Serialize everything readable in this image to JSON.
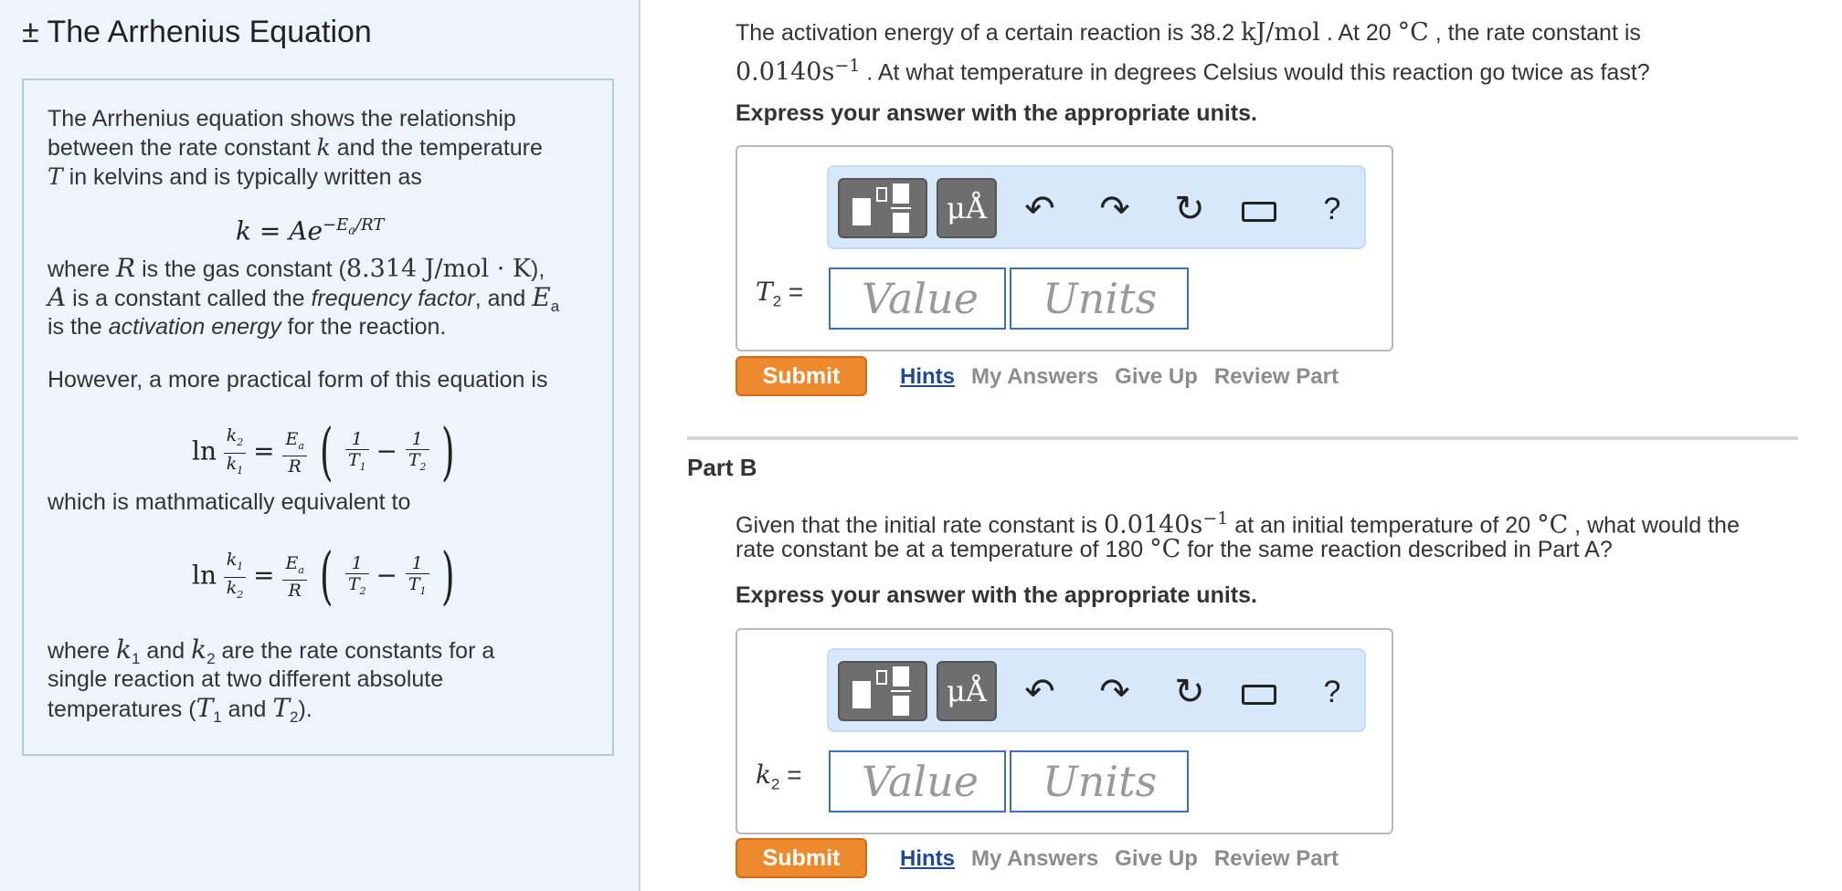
{
  "sidebar": {
    "title": "± The Arrhenius Equation",
    "intro_line1": "The Arrhenius equation shows the relationship",
    "intro_line2_a": "between the rate constant ",
    "intro_line2_b": " and the temperature",
    "intro_line3": " in kelvins and is typically written as",
    "eq_main": "k = Ae",
    "eq_main_exp": "−E",
    "eq_main_exp2": "/RT",
    "where_line1_a": "where ",
    "where_line1_b": " is the gas constant (",
    "where_line1_val": "8.314 J/mol · K",
    "where_line1_c": "),",
    "where_line2_a": " is a constant called the ",
    "where_line2_em": "frequency factor",
    "where_line2_b": ", and ",
    "where_line3_a": "is the ",
    "where_line3_em": "activation energy",
    "where_line3_b": " for the reaction.",
    "practical": "However, a more practical form of this equation is",
    "equivalent": "which is mathmatically equivalent to",
    "final_line1_a": "where ",
    "final_line1_b": " and ",
    "final_line1_c": " are the rate constants for a",
    "final_line2": "single reaction at two different absolute",
    "final_line3_a": "temperatures (",
    "final_line3_b": " and ",
    "final_line3_c": ")."
  },
  "partA": {
    "q_line1_a": "The activation energy of a certain reaction is 38.2 ",
    "q_line1_unit": "kJ/mol",
    "q_line1_b": " . At 20 ",
    "q_line1_deg": "°C",
    "q_line1_c": " , the rate constant is",
    "q_line2_val": "0.0140s",
    "q_line2_sup": "−1",
    "q_line2_b": " . At what temperature in degrees Celsius would this reaction go twice as fast?",
    "instruction": "Express your answer with the appropriate units.",
    "var_label": "T",
    "var_sub": "2",
    "value_placeholder": "Value",
    "units_placeholder": "Units"
  },
  "partB": {
    "heading": "Part B",
    "q_line1_a": "Given that the initial rate constant is ",
    "q_line1_val": "0.0140s",
    "q_line1_sup": "−1",
    "q_line1_b": " at an initial temperature of 20 ",
    "q_line1_deg": "°C",
    "q_line1_c": " , what would the",
    "q_line2_a": "rate constant be at a temperature of 180 ",
    "q_line2_deg": "°C",
    "q_line2_b": " for the same reaction described in Part A?",
    "instruction": "Express your answer with the appropriate units.",
    "var_label": "k",
    "var_sub": "2",
    "value_placeholder": "Value",
    "units_placeholder": "Units"
  },
  "toolbar": {
    "units_label": "μÅ",
    "help_label": "?"
  },
  "actions": {
    "submit": "Submit",
    "hints": "Hints",
    "my_answers": "My Answers",
    "give_up": "Give Up",
    "review_part": "Review Part"
  },
  "colors": {
    "submit_orange": "#ec8a2d",
    "field_border": "#3a6fc4",
    "toolbar_bg": "#d7e8fb",
    "panel_bg": "#eef4fb"
  }
}
